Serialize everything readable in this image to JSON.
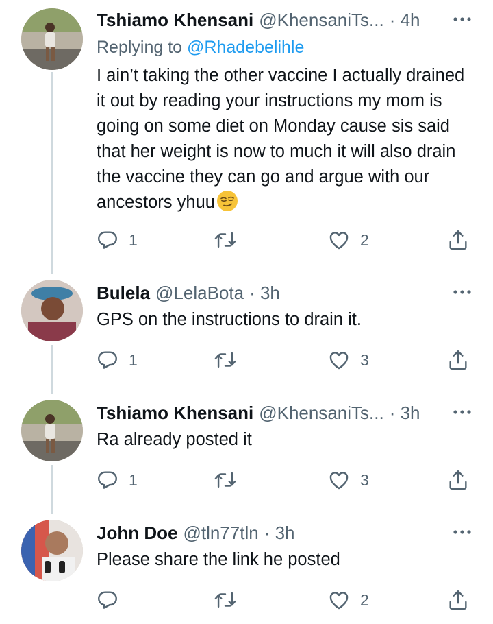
{
  "tweets": [
    {
      "name": "Tshiamo Khensani",
      "handle": "@KhensaniTs...",
      "time": "· 4h",
      "replying_label": "Replying to ",
      "replying_handle": "@Rhadebelihle",
      "text": "I ain’t taking the other vaccine I actually drained it out by reading your instructions my mom is going on some diet on Monday cause sis said that her weight is now to much it will also drain the vaccine they can go and argue with our ancestors yhuu",
      "emoji": "smirking-face",
      "replies": "1",
      "retweets": "",
      "likes": "2"
    },
    {
      "name": "Bulela",
      "handle": "@LelaBota",
      "time": "· 3h",
      "text": "GPS on the instructions to drain it.",
      "replies": "1",
      "retweets": "",
      "likes": "3"
    },
    {
      "name": "Tshiamo Khensani",
      "handle": "@KhensaniTs...",
      "time": "· 3h",
      "text": "Ra already posted it",
      "replies": "1",
      "retweets": "",
      "likes": "3"
    },
    {
      "name": "John Doe",
      "handle": "@tln77tln",
      "time": "· 3h",
      "text": "Please share the link he posted",
      "replies": "",
      "retweets": "",
      "likes": "2"
    }
  ],
  "colors": {
    "text": "#0f1419",
    "secondary": "#536471",
    "link": "#1d9bf0",
    "thread_line": "#cfd9de"
  }
}
